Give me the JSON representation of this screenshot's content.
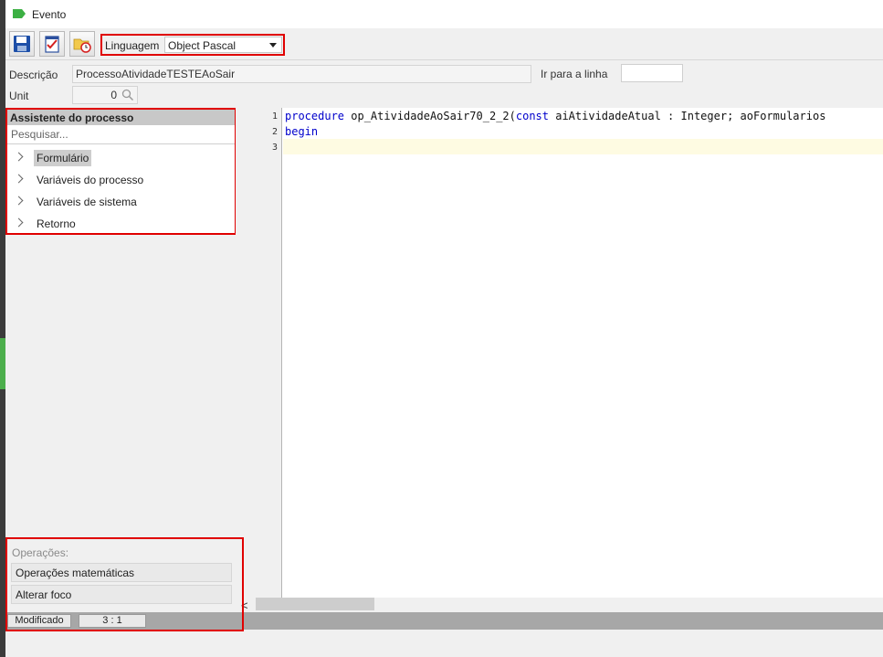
{
  "window": {
    "title": "Evento"
  },
  "toolbar": {
    "buttons": [
      {
        "icon": "save-icon"
      },
      {
        "icon": "check-document-icon"
      },
      {
        "icon": "folder-clock-icon"
      }
    ],
    "language_label": "Linguagem",
    "language_value": "Object Pascal"
  },
  "fields": {
    "descricao_label": "Descrição",
    "descricao_value": "ProcessoAtividadeTESTEAoSair",
    "ir_para_linha_label": "Ir para a linha",
    "ir_para_linha_value": "",
    "unit_label": "Unit",
    "unit_value": "0"
  },
  "assistant": {
    "title": "Assistente do processo",
    "search_placeholder": "Pesquisar...",
    "items": [
      {
        "label": "Formulário",
        "selected": true
      },
      {
        "label": "Variáveis do processo",
        "selected": false
      },
      {
        "label": "Variáveis de sistema",
        "selected": false
      },
      {
        "label": "Retorno",
        "selected": false
      }
    ]
  },
  "editor": {
    "line_numbers": [
      "1",
      "2",
      "3"
    ],
    "lines": [
      {
        "kw1": "procedure",
        "text1": " op_AtividadeAoSair70_2_2(",
        "kw2": "const",
        "text2": " aiAtividadeAtual : Integer; aoFormularios"
      },
      {
        "kw1": "begin"
      },
      {
        "text1": ""
      }
    ]
  },
  "scrollbar": {
    "left_arrow": "<"
  },
  "operations": {
    "title": "Operações:",
    "buttons": [
      "Operações matemáticas",
      "Alterar foco"
    ]
  },
  "status": {
    "state": "Modificado",
    "position": "3 : 1"
  },
  "colors": {
    "highlight_border": "#e00000",
    "keyword": "#0000cc",
    "current_line": "#fefbe2"
  }
}
